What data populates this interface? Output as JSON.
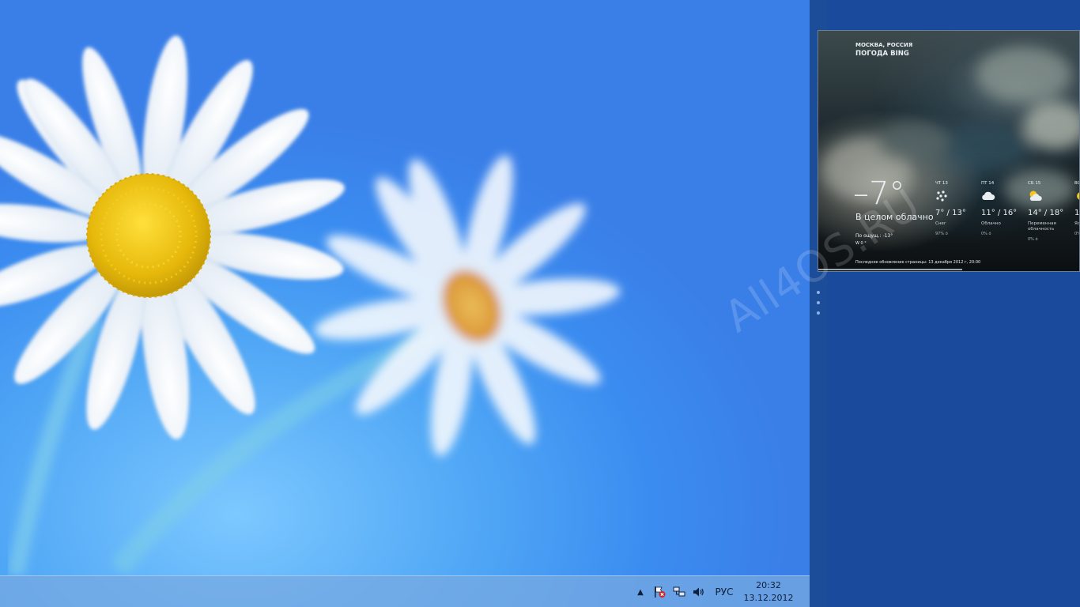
{
  "taskbar": {
    "overflow_glyph": "▲",
    "language": "РУС",
    "time": "20:32",
    "date": "13.12.2012",
    "icons": [
      "show-hidden-icons-icon",
      "action-center-flag-icon",
      "network-icon",
      "volume-icon"
    ]
  },
  "weather": {
    "location": "МОСКВА, РОССИЯ",
    "source": "ПОГОДА BING",
    "temperature": "–7°",
    "condition": "В целом облачно",
    "feels_like": "По ощущ.: -13°",
    "feels_sub": "W 0 °",
    "updated": "Последнее обновление страницы: 13 декабря 2012 г, 20:00",
    "forecast": [
      {
        "day": "ЧТ 13",
        "icon": "snow-icon",
        "temps": "7° / 13°",
        "cond": "Снег",
        "precip": "97% ó"
      },
      {
        "day": "ПТ 14",
        "icon": "cloud-icon",
        "temps": "11° / 16°",
        "cond": "Облачно",
        "precip": "0% ó"
      },
      {
        "day": "СБ 15",
        "icon": "partly-cloudy-icon",
        "temps": "14° / 18°",
        "cond": "Переменная облачность",
        "precip": "0% ó"
      },
      {
        "day": "ВС",
        "icon": "sun-icon",
        "temps": "1",
        "cond": "Яс",
        "precip": "0%"
      }
    ]
  },
  "watermark": "All4OS.RU",
  "colors": {
    "desktop_blue": "#3b8cf0",
    "snap_blue": "#1a4a9c",
    "splitter": "#1c4d99"
  }
}
